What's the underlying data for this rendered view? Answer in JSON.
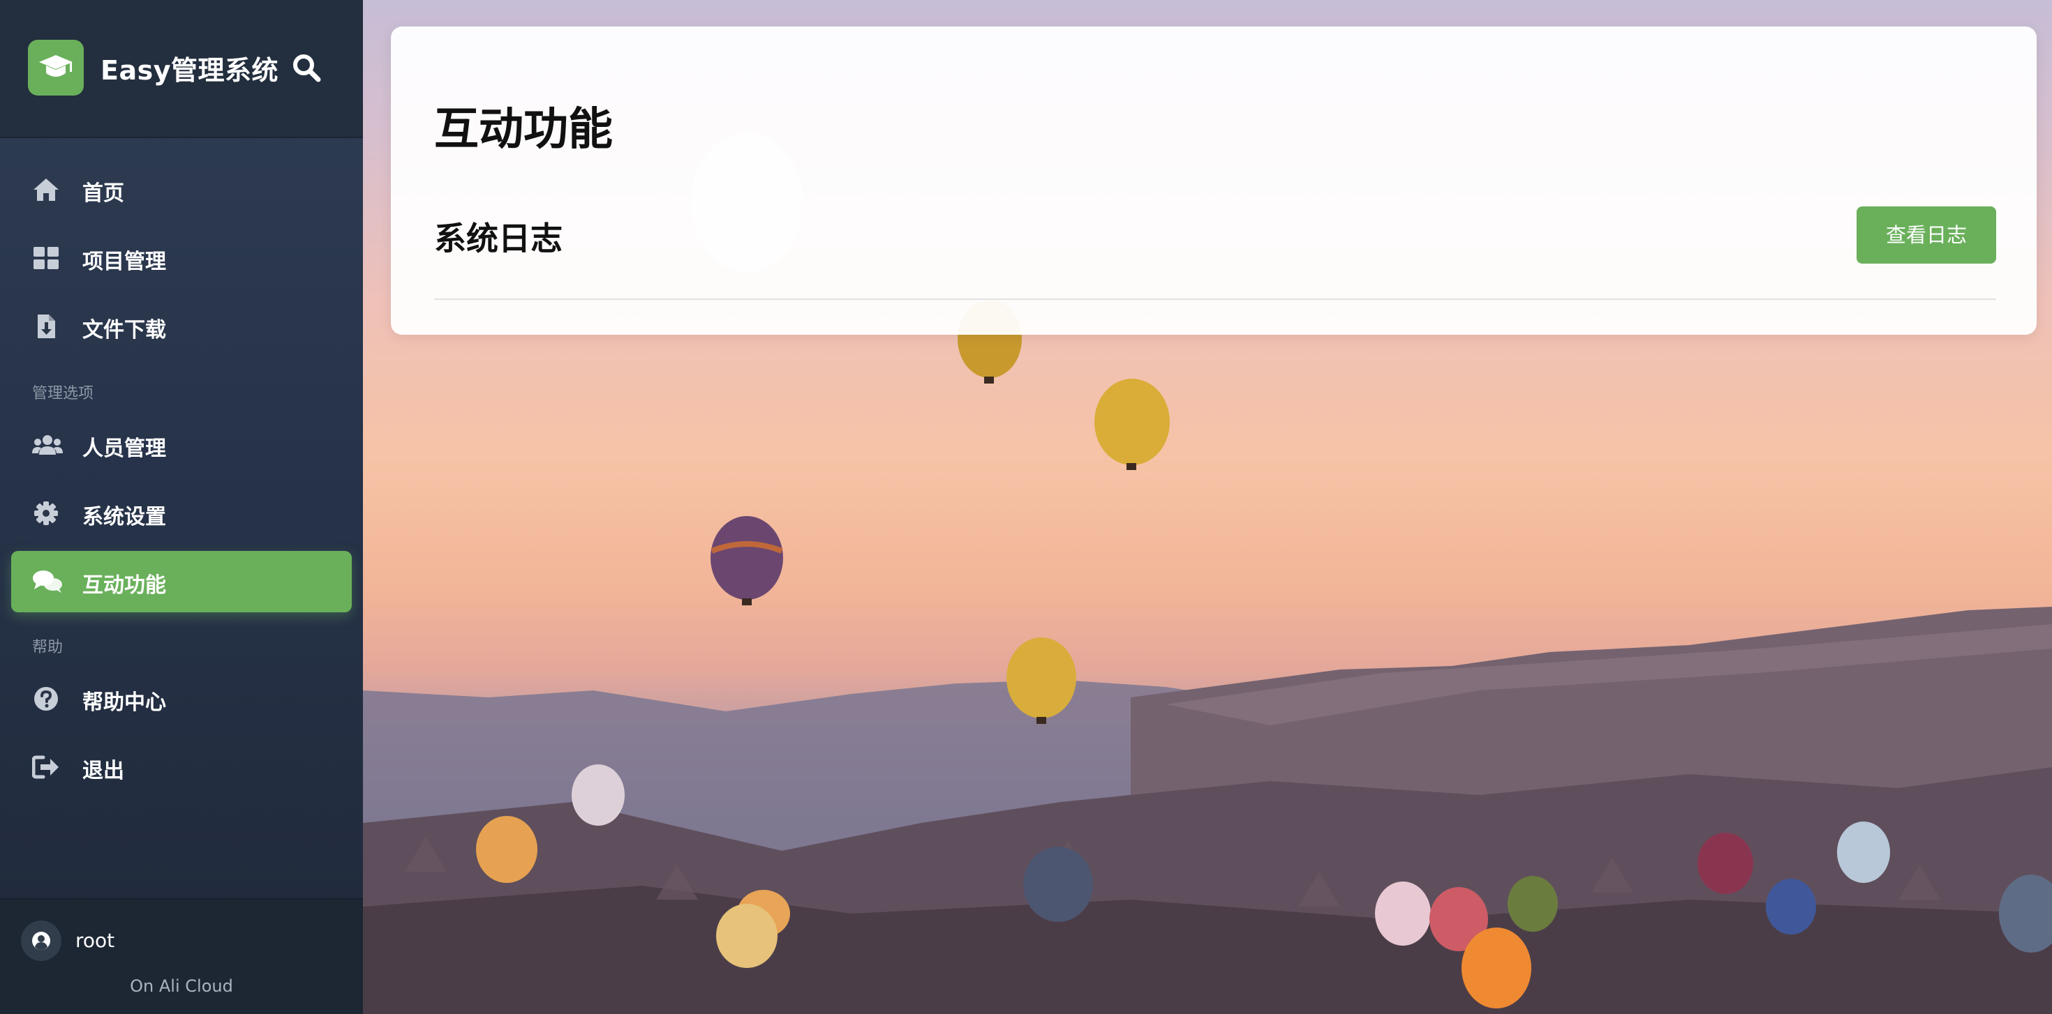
{
  "brand": {
    "title": "Easy管理系统",
    "logo_icon": "graduation-cap-icon",
    "search_icon": "search-icon",
    "accent_color": "#6ab05b"
  },
  "sidebar": {
    "items": [
      {
        "label": "首页",
        "icon": "home-icon"
      },
      {
        "label": "项目管理",
        "icon": "grid-icon"
      },
      {
        "label": "文件下载",
        "icon": "file-download-icon"
      }
    ],
    "section_manage": "管理选项",
    "manage_items": [
      {
        "label": "人员管理",
        "icon": "users-icon"
      },
      {
        "label": "系统设置",
        "icon": "gear-icon"
      },
      {
        "label": "互动功能",
        "icon": "chat-icon",
        "active": true
      }
    ],
    "section_help": "帮助",
    "help_items": [
      {
        "label": "帮助中心",
        "icon": "question-circle-icon"
      },
      {
        "label": "退出",
        "icon": "sign-out-icon"
      }
    ]
  },
  "footer": {
    "username": "root",
    "host": "On Ali Cloud",
    "avatar_icon": "user-circle-icon"
  },
  "main": {
    "title": "互动功能",
    "section_title": "系统日志",
    "view_log_button": "查看日志"
  }
}
